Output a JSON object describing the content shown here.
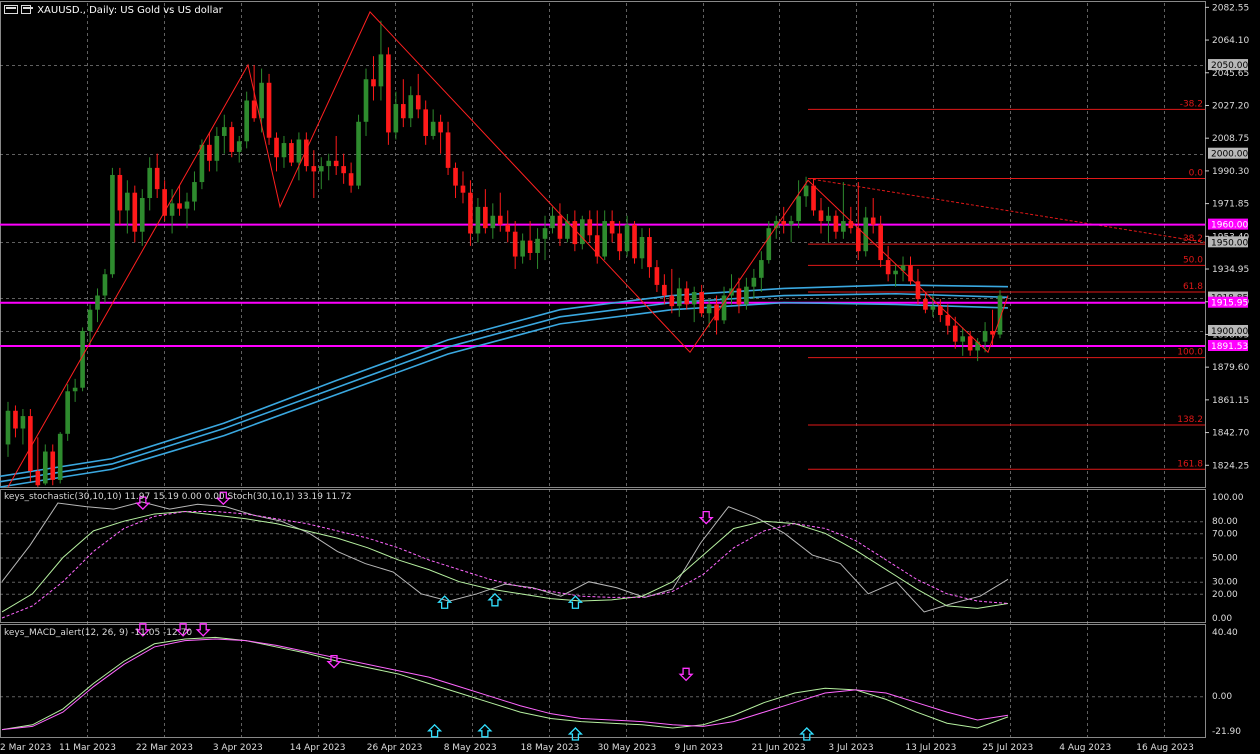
{
  "title": {
    "symbol": "XAUUSD.",
    "timeframe": "Daily",
    "description": "US Gold vs US dollar"
  },
  "colors": {
    "background": "#000000",
    "bull_candle": "#2e8b2e",
    "bear_candle": "#ff1a1a",
    "grid": "#b0b0b0",
    "ma": "#3aa8e0",
    "level": "#ff00ff",
    "zigzag": "#ff2020",
    "fib": "#e01818",
    "stoch_main": "#b8b8b8",
    "stoch_k": "#b6f0a0",
    "stoch_d": "#ff66ff",
    "macd_main": "#b6f0a0",
    "macd_signal": "#ff66ff",
    "arrow_down": "#ff33ff",
    "arrow_up": "#33e0ff"
  },
  "price_axis": {
    "ticks": [
      "2082.55",
      "2064.10",
      "2045.65",
      "2027.20",
      "2008.75",
      "1990.30",
      "1971.85",
      "1953.40",
      "1934.95",
      "1916.50",
      "1898.05",
      "1879.60",
      "1861.15",
      "1842.70",
      "1824.25"
    ],
    "range": [
      1812,
      2085
    ]
  },
  "price_labels": [
    {
      "text": "2050.00",
      "price": 2050.0,
      "kind": "round"
    },
    {
      "text": "2000.00",
      "price": 2000.0,
      "kind": "round"
    },
    {
      "text": "1960.00",
      "price": 1960.0,
      "kind": "level"
    },
    {
      "text": "1950.00",
      "price": 1950.0,
      "kind": "round"
    },
    {
      "text": "1918.85",
      "price": 1918.85,
      "kind": "round"
    },
    {
      "text": "1915.95",
      "price": 1915.95,
      "kind": "level"
    },
    {
      "text": "1900.00",
      "price": 1900.0,
      "kind": "round"
    },
    {
      "text": "1891.53",
      "price": 1891.53,
      "kind": "level"
    }
  ],
  "fib_levels": [
    {
      "label": "-38.2",
      "price": 2025.0
    },
    {
      "label": "0.0",
      "price": 1986.0
    },
    {
      "label": "-38.2",
      "price": 1949.0
    },
    {
      "label": "50.0",
      "price": 1937.0
    },
    {
      "label": "61.8",
      "price": 1922.0
    },
    {
      "label": "100.0",
      "price": 1885.0
    },
    {
      "label": "138.2",
      "price": 1847.0
    },
    {
      "label": "161.8",
      "price": 1822.0
    }
  ],
  "date_axis": [
    "2 Mar 2023",
    "11 Mar 2023",
    "22 Mar 2023",
    "3 Apr 2023",
    "14 Apr 2023",
    "26 Apr 2023",
    "8 May 2023",
    "18 May 2023",
    "30 May 2023",
    "9 Jun 2023",
    "21 Jun 2023",
    "3 Jul 2023",
    "13 Jul 2023",
    "25 Jul 2023",
    "4 Aug 2023",
    "16 Aug 2023"
  ],
  "stochastic": {
    "title": "keys_stochastic(30,10,10) 11.97 15.19 0.00 0.00 Stoch(30,10,1) 33.19 11.72",
    "ticks": [
      "100.00",
      "80.00",
      "70.00",
      "50.00",
      "30.00",
      "20.00",
      "0.00"
    ],
    "range": [
      0,
      100
    ]
  },
  "macd": {
    "title": "keys_MACD_alert(12, 26, 9) -11.05 -12.70",
    "ticks": [
      "40.40",
      "0.00",
      "-21.90"
    ],
    "range": [
      -21.9,
      40.4
    ]
  },
  "chart_data": {
    "type": "candlestick",
    "panels": [
      "price",
      "stochastic",
      "macd"
    ],
    "candles": [
      {
        "o": 1836,
        "h": 1860,
        "l": 1829,
        "c": 1855
      },
      {
        "o": 1855,
        "h": 1858,
        "l": 1840,
        "c": 1845
      },
      {
        "o": 1845,
        "h": 1856,
        "l": 1836,
        "c": 1852
      },
      {
        "o": 1852,
        "h": 1856,
        "l": 1815,
        "c": 1821
      },
      {
        "o": 1821,
        "h": 1840,
        "l": 1812,
        "c": 1813
      },
      {
        "o": 1814,
        "h": 1836,
        "l": 1813,
        "c": 1832
      },
      {
        "o": 1832,
        "h": 1836,
        "l": 1813,
        "c": 1816
      },
      {
        "o": 1816,
        "h": 1843,
        "l": 1814,
        "c": 1842
      },
      {
        "o": 1842,
        "h": 1870,
        "l": 1838,
        "c": 1866
      },
      {
        "o": 1866,
        "h": 1873,
        "l": 1860,
        "c": 1868
      },
      {
        "o": 1868,
        "h": 1902,
        "l": 1866,
        "c": 1900
      },
      {
        "o": 1900,
        "h": 1915,
        "l": 1892,
        "c": 1912
      },
      {
        "o": 1912,
        "h": 1924,
        "l": 1905,
        "c": 1920
      },
      {
        "o": 1920,
        "h": 1935,
        "l": 1916,
        "c": 1932
      },
      {
        "o": 1932,
        "h": 1992,
        "l": 1930,
        "c": 1988
      },
      {
        "o": 1988,
        "h": 1992,
        "l": 1960,
        "c": 1968
      },
      {
        "o": 1968,
        "h": 1985,
        "l": 1955,
        "c": 1978
      },
      {
        "o": 1978,
        "h": 1982,
        "l": 1950,
        "c": 1956
      },
      {
        "o": 1956,
        "h": 1980,
        "l": 1948,
        "c": 1975
      },
      {
        "o": 1975,
        "h": 1998,
        "l": 1968,
        "c": 1992
      },
      {
        "o": 1992,
        "h": 2000,
        "l": 1975,
        "c": 1980
      },
      {
        "o": 1980,
        "h": 1985,
        "l": 1962,
        "c": 1965
      },
      {
        "o": 1965,
        "h": 1980,
        "l": 1955,
        "c": 1972
      },
      {
        "o": 1972,
        "h": 1982,
        "l": 1965,
        "c": 1969
      },
      {
        "o": 1969,
        "h": 1978,
        "l": 1958,
        "c": 1973
      },
      {
        "o": 1973,
        "h": 1990,
        "l": 1968,
        "c": 1984
      },
      {
        "o": 1984,
        "h": 2008,
        "l": 1980,
        "c": 2005
      },
      {
        "o": 2005,
        "h": 2012,
        "l": 1990,
        "c": 1996
      },
      {
        "o": 1996,
        "h": 2015,
        "l": 1990,
        "c": 2010
      },
      {
        "o": 2010,
        "h": 2022,
        "l": 2000,
        "c": 2015
      },
      {
        "o": 2015,
        "h": 2018,
        "l": 1998,
        "c": 2001
      },
      {
        "o": 2001,
        "h": 2010,
        "l": 1995,
        "c": 2007
      },
      {
        "o": 2007,
        "h": 2035,
        "l": 2003,
        "c": 2030
      },
      {
        "o": 2030,
        "h": 2050,
        "l": 2018,
        "c": 2020
      },
      {
        "o": 2020,
        "h": 2048,
        "l": 2012,
        "c": 2040
      },
      {
        "o": 2040,
        "h": 2045,
        "l": 2005,
        "c": 2009
      },
      {
        "o": 2009,
        "h": 2012,
        "l": 1990,
        "c": 1998
      },
      {
        "o": 1998,
        "h": 2010,
        "l": 1992,
        "c": 2006
      },
      {
        "o": 2006,
        "h": 2008,
        "l": 1993,
        "c": 1995
      },
      {
        "o": 1995,
        "h": 2012,
        "l": 1985,
        "c": 2008
      },
      {
        "o": 2008,
        "h": 2012,
        "l": 1990,
        "c": 1993
      },
      {
        "o": 1993,
        "h": 2002,
        "l": 1975,
        "c": 1990
      },
      {
        "o": 1990,
        "h": 1998,
        "l": 1980,
        "c": 1993
      },
      {
        "o": 1993,
        "h": 2000,
        "l": 1985,
        "c": 1996
      },
      {
        "o": 1996,
        "h": 2010,
        "l": 1988,
        "c": 1993
      },
      {
        "o": 1993,
        "h": 2000,
        "l": 1983,
        "c": 1989
      },
      {
        "o": 1989,
        "h": 1995,
        "l": 1978,
        "c": 1982
      },
      {
        "o": 1982,
        "h": 2022,
        "l": 1980,
        "c": 2018
      },
      {
        "o": 2018,
        "h": 2048,
        "l": 2010,
        "c": 2042
      },
      {
        "o": 2042,
        "h": 2055,
        "l": 2030,
        "c": 2038
      },
      {
        "o": 2038,
        "h": 2075,
        "l": 2030,
        "c": 2056
      },
      {
        "o": 2056,
        "h": 2060,
        "l": 2005,
        "c": 2012
      },
      {
        "o": 2012,
        "h": 2035,
        "l": 2008,
        "c": 2028
      },
      {
        "o": 2028,
        "h": 2042,
        "l": 2015,
        "c": 2020
      },
      {
        "o": 2020,
        "h": 2038,
        "l": 2015,
        "c": 2033
      },
      {
        "o": 2033,
        "h": 2045,
        "l": 2020,
        "c": 2025
      },
      {
        "o": 2025,
        "h": 2030,
        "l": 2005,
        "c": 2010
      },
      {
        "o": 2010,
        "h": 2025,
        "l": 2008,
        "c": 2018
      },
      {
        "o": 2018,
        "h": 2022,
        "l": 2000,
        "c": 2012
      },
      {
        "o": 2012,
        "h": 2018,
        "l": 1988,
        "c": 1992
      },
      {
        "o": 1992,
        "h": 1995,
        "l": 1975,
        "c": 1982
      },
      {
        "o": 1982,
        "h": 1990,
        "l": 1972,
        "c": 1978
      },
      {
        "o": 1978,
        "h": 1985,
        "l": 1948,
        "c": 1955
      },
      {
        "o": 1955,
        "h": 1975,
        "l": 1950,
        "c": 1970
      },
      {
        "o": 1970,
        "h": 1980,
        "l": 1955,
        "c": 1958
      },
      {
        "o": 1958,
        "h": 1972,
        "l": 1952,
        "c": 1965
      },
      {
        "o": 1965,
        "h": 1978,
        "l": 1956,
        "c": 1960
      },
      {
        "o": 1960,
        "h": 1968,
        "l": 1950,
        "c": 1956
      },
      {
        "o": 1956,
        "h": 1962,
        "l": 1935,
        "c": 1942
      },
      {
        "o": 1942,
        "h": 1955,
        "l": 1938,
        "c": 1951
      },
      {
        "o": 1951,
        "h": 1962,
        "l": 1940,
        "c": 1944
      },
      {
        "o": 1944,
        "h": 1958,
        "l": 1935,
        "c": 1952
      },
      {
        "o": 1952,
        "h": 1965,
        "l": 1940,
        "c": 1958
      },
      {
        "o": 1958,
        "h": 1970,
        "l": 1955,
        "c": 1965
      },
      {
        "o": 1965,
        "h": 1972,
        "l": 1948,
        "c": 1952
      },
      {
        "o": 1952,
        "h": 1966,
        "l": 1950,
        "c": 1962
      },
      {
        "o": 1962,
        "h": 1968,
        "l": 1945,
        "c": 1949
      },
      {
        "o": 1949,
        "h": 1965,
        "l": 1946,
        "c": 1963
      },
      {
        "o": 1963,
        "h": 1968,
        "l": 1950,
        "c": 1954
      },
      {
        "o": 1954,
        "h": 1968,
        "l": 1938,
        "c": 1942
      },
      {
        "o": 1942,
        "h": 1968,
        "l": 1940,
        "c": 1962
      },
      {
        "o": 1962,
        "h": 1968,
        "l": 1950,
        "c": 1955
      },
      {
        "o": 1955,
        "h": 1962,
        "l": 1940,
        "c": 1945
      },
      {
        "o": 1945,
        "h": 1965,
        "l": 1942,
        "c": 1960
      },
      {
        "o": 1960,
        "h": 1962,
        "l": 1938,
        "c": 1941
      },
      {
        "o": 1941,
        "h": 1958,
        "l": 1935,
        "c": 1953
      },
      {
        "o": 1953,
        "h": 1958,
        "l": 1930,
        "c": 1936
      },
      {
        "o": 1936,
        "h": 1940,
        "l": 1922,
        "c": 1926
      },
      {
        "o": 1926,
        "h": 1932,
        "l": 1915,
        "c": 1920
      },
      {
        "o": 1920,
        "h": 1935,
        "l": 1910,
        "c": 1914
      },
      {
        "o": 1914,
        "h": 1930,
        "l": 1908,
        "c": 1924
      },
      {
        "o": 1924,
        "h": 1928,
        "l": 1912,
        "c": 1915
      },
      {
        "o": 1915,
        "h": 1925,
        "l": 1905,
        "c": 1922
      },
      {
        "o": 1922,
        "h": 1926,
        "l": 1908,
        "c": 1910
      },
      {
        "o": 1910,
        "h": 1918,
        "l": 1902,
        "c": 1915
      },
      {
        "o": 1915,
        "h": 1920,
        "l": 1898,
        "c": 1906
      },
      {
        "o": 1906,
        "h": 1925,
        "l": 1904,
        "c": 1920
      },
      {
        "o": 1920,
        "h": 1932,
        "l": 1915,
        "c": 1924
      },
      {
        "o": 1924,
        "h": 1930,
        "l": 1910,
        "c": 1915
      },
      {
        "o": 1915,
        "h": 1930,
        "l": 1912,
        "c": 1925
      },
      {
        "o": 1925,
        "h": 1935,
        "l": 1918,
        "c": 1930
      },
      {
        "o": 1930,
        "h": 1945,
        "l": 1922,
        "c": 1940
      },
      {
        "o": 1940,
        "h": 1962,
        "l": 1938,
        "c": 1958
      },
      {
        "o": 1958,
        "h": 1965,
        "l": 1952,
        "c": 1962
      },
      {
        "o": 1962,
        "h": 1970,
        "l": 1955,
        "c": 1960
      },
      {
        "o": 1960,
        "h": 1965,
        "l": 1950,
        "c": 1962
      },
      {
        "o": 1962,
        "h": 1985,
        "l": 1958,
        "c": 1976
      },
      {
        "o": 1976,
        "h": 1987,
        "l": 1970,
        "c": 1982
      },
      {
        "o": 1982,
        "h": 1986,
        "l": 1965,
        "c": 1968
      },
      {
        "o": 1968,
        "h": 1975,
        "l": 1955,
        "c": 1962
      },
      {
        "o": 1962,
        "h": 1970,
        "l": 1950,
        "c": 1965
      },
      {
        "o": 1965,
        "h": 1968,
        "l": 1952,
        "c": 1956
      },
      {
        "o": 1956,
        "h": 1984,
        "l": 1952,
        "c": 1962
      },
      {
        "o": 1962,
        "h": 1970,
        "l": 1955,
        "c": 1958
      },
      {
        "o": 1958,
        "h": 1984,
        "l": 1940,
        "c": 1945
      },
      {
        "o": 1945,
        "h": 1970,
        "l": 1942,
        "c": 1964
      },
      {
        "o": 1964,
        "h": 1975,
        "l": 1955,
        "c": 1960
      },
      {
        "o": 1960,
        "h": 1965,
        "l": 1936,
        "c": 1940
      },
      {
        "o": 1940,
        "h": 1948,
        "l": 1928,
        "c": 1932
      },
      {
        "o": 1932,
        "h": 1938,
        "l": 1925,
        "c": 1934
      },
      {
        "o": 1934,
        "h": 1942,
        "l": 1928,
        "c": 1937
      },
      {
        "o": 1937,
        "h": 1942,
        "l": 1926,
        "c": 1928
      },
      {
        "o": 1928,
        "h": 1935,
        "l": 1915,
        "c": 1918
      },
      {
        "o": 1918,
        "h": 1922,
        "l": 1910,
        "c": 1912
      },
      {
        "o": 1912,
        "h": 1920,
        "l": 1908,
        "c": 1914
      },
      {
        "o": 1914,
        "h": 1918,
        "l": 1905,
        "c": 1909
      },
      {
        "o": 1909,
        "h": 1915,
        "l": 1898,
        "c": 1903
      },
      {
        "o": 1903,
        "h": 1908,
        "l": 1890,
        "c": 1894
      },
      {
        "o": 1894,
        "h": 1902,
        "l": 1886,
        "c": 1897
      },
      {
        "o": 1897,
        "h": 1900,
        "l": 1886,
        "c": 1889
      },
      {
        "o": 1889,
        "h": 1896,
        "l": 1883,
        "c": 1894
      },
      {
        "o": 1894,
        "h": 1905,
        "l": 1888,
        "c": 1900
      },
      {
        "o": 1900,
        "h": 1912,
        "l": 1892,
        "c": 1898
      },
      {
        "o": 1898,
        "h": 1923,
        "l": 1896,
        "c": 1920
      }
    ],
    "moving_averages": [
      {
        "name": "MA high",
        "values": [
          1818,
          1828,
          1848,
          1872,
          1895,
          1912,
          1920,
          1924,
          1926,
          1925
        ]
      },
      {
        "name": "MA mid",
        "values": [
          1815,
          1825,
          1845,
          1868,
          1891,
          1908,
          1916,
          1920,
          1921,
          1919
        ]
      },
      {
        "name": "MA low",
        "values": [
          1812,
          1822,
          1841,
          1864,
          1887,
          1904,
          1912,
          1916,
          1915,
          1913
        ]
      }
    ],
    "zigzag": [
      1812,
      2050,
      1970,
      2080,
      1888,
      1985,
      1888,
      1920
    ],
    "stochastic_main": [
      30,
      60,
      95,
      92,
      90,
      96,
      90,
      94,
      92,
      85,
      80,
      70,
      55,
      45,
      38,
      20,
      14,
      20,
      28,
      25,
      18,
      30,
      25,
      17,
      24,
      62,
      92,
      83,
      70,
      52,
      45,
      20,
      30,
      5,
      12,
      18,
      32
    ],
    "stochastic_k": [
      5,
      20,
      50,
      72,
      80,
      86,
      88,
      85,
      82,
      78,
      72,
      66,
      58,
      48,
      40,
      30,
      24,
      20,
      16,
      14,
      15,
      18,
      30,
      52,
      74,
      80,
      78,
      70,
      56,
      40,
      24,
      10,
      8,
      12
    ],
    "stochastic_d": [
      0,
      10,
      30,
      55,
      74,
      84,
      88,
      88,
      86,
      82,
      78,
      72,
      66,
      58,
      48,
      40,
      32,
      26,
      22,
      18,
      17,
      17,
      22,
      36,
      58,
      72,
      78,
      74,
      64,
      48,
      32,
      20,
      14,
      12
    ],
    "stochastic_signals": [
      {
        "dir": "down",
        "pos": 0.14,
        "value": 90
      },
      {
        "dir": "down",
        "pos": 0.22,
        "value": 94
      },
      {
        "dir": "up",
        "pos": 0.44,
        "value": 18
      },
      {
        "dir": "up",
        "pos": 0.49,
        "value": 20
      },
      {
        "dir": "up",
        "pos": 0.57,
        "value": 18
      },
      {
        "dir": "down",
        "pos": 0.7,
        "value": 78
      }
    ],
    "macd_main": [
      -21,
      -18,
      -8,
      8,
      22,
      33,
      36,
      37,
      35,
      31,
      27,
      22,
      18,
      14,
      8,
      2,
      -4,
      -10,
      -14,
      -16,
      -17,
      -18,
      -20,
      -18,
      -12,
      -4,
      2,
      5,
      4,
      -2,
      -10,
      -17,
      -20,
      -13
    ],
    "macd_signal": [
      -21,
      -19,
      -10,
      6,
      20,
      31,
      35,
      36,
      35,
      32,
      28,
      24,
      20,
      16,
      12,
      6,
      0,
      -6,
      -11,
      -14,
      -15,
      -16,
      -18,
      -19,
      -16,
      -10,
      -4,
      2,
      4,
      2,
      -4,
      -10,
      -15,
      -12
    ],
    "macd_signals": [
      {
        "dir": "down",
        "pos": 0.14,
        "value": 38
      },
      {
        "dir": "down",
        "pos": 0.18,
        "value": 38
      },
      {
        "dir": "down",
        "pos": 0.2,
        "value": 38
      },
      {
        "dir": "down",
        "pos": 0.33,
        "value": 18
      },
      {
        "dir": "up",
        "pos": 0.43,
        "value": -18
      },
      {
        "dir": "up",
        "pos": 0.48,
        "value": -18
      },
      {
        "dir": "up",
        "pos": 0.57,
        "value": -20
      },
      {
        "dir": "down",
        "pos": 0.68,
        "value": 10
      },
      {
        "dir": "up",
        "pos": 0.8,
        "value": -20
      }
    ]
  }
}
